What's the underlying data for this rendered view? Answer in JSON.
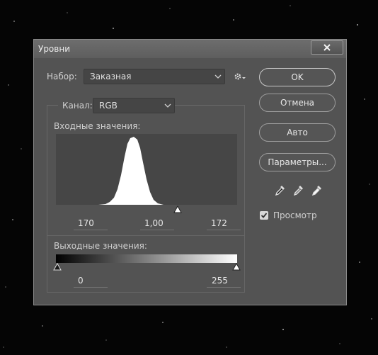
{
  "dialog": {
    "title": "Уровни"
  },
  "preset": {
    "label": "Набор:",
    "value": "Заказная"
  },
  "channel": {
    "label": "Канал:",
    "value": "RGB"
  },
  "input_levels": {
    "label": "Входные значения:",
    "black": "170",
    "gamma": "1,00",
    "white": "172"
  },
  "output_levels": {
    "label": "Выходные значения:",
    "black": "0",
    "white": "255"
  },
  "buttons": {
    "ok": "OK",
    "cancel": "Отмена",
    "auto": "Авто",
    "options": "Параметры..."
  },
  "preview": {
    "label": "Просмотр",
    "checked": true
  },
  "icons": {
    "close": "close-icon",
    "gear": "gear-icon",
    "chevron": "chevron-down-icon",
    "eyedroppers": [
      "black-point-eyedropper-icon",
      "gray-point-eyedropper-icon",
      "white-point-eyedropper-icon"
    ]
  },
  "colors": {
    "dialog_bg": "#535353",
    "histogram_bg": "#464646",
    "histogram_fill": "#ffffff"
  }
}
